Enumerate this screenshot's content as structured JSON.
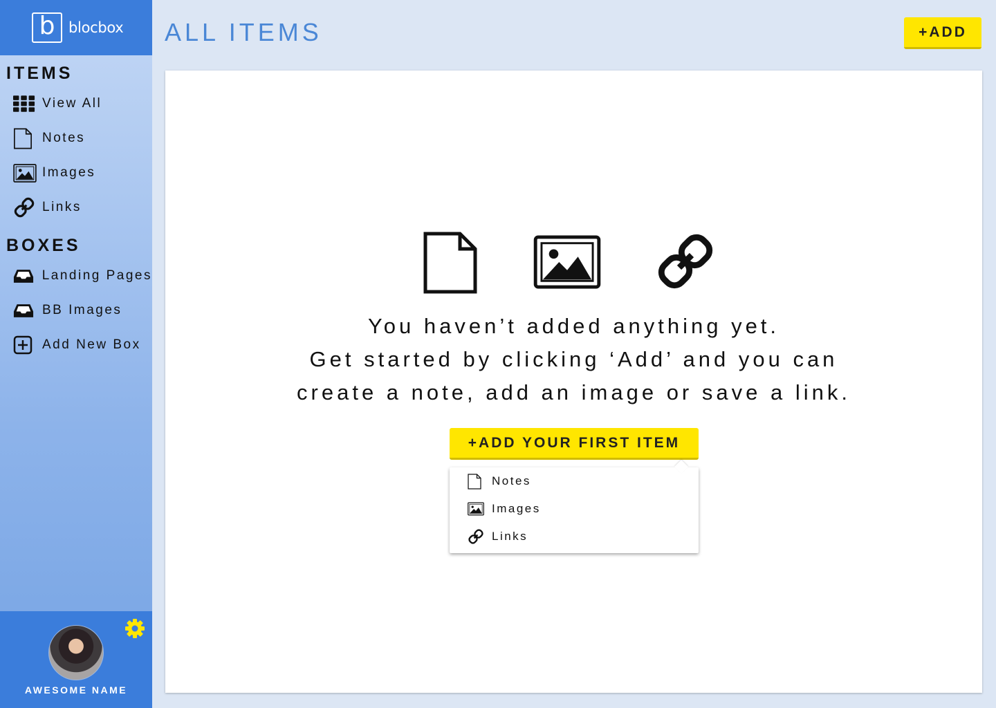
{
  "brand": {
    "logo_letter": "b",
    "name": "blocbox",
    "color": "#3b7ddb"
  },
  "sidebar": {
    "items_title": "ITEMS",
    "items": [
      {
        "label": "View All",
        "icon": "grid-icon"
      },
      {
        "label": "Notes",
        "icon": "document-icon"
      },
      {
        "label": "Images",
        "icon": "image-icon"
      },
      {
        "label": "Links",
        "icon": "link-icon"
      }
    ],
    "boxes_title": "BOXES",
    "boxes": [
      {
        "label": "Landing Pages",
        "icon": "inbox-icon"
      },
      {
        "label": "BB Images",
        "icon": "inbox-icon"
      },
      {
        "label": "Add New Box",
        "icon": "plus-square-icon"
      }
    ]
  },
  "profile": {
    "name": "AWESOME NAME",
    "settings_icon": "gear-icon",
    "gear_color": "#ffe600"
  },
  "header": {
    "title": "ALL ITEMS",
    "add_label": "+ADD",
    "accent": "#ffe600"
  },
  "empty_state": {
    "icons": [
      "document-icon",
      "image-icon",
      "link-icon"
    ],
    "lines": [
      "You haven’t added anything yet.",
      "Get started by clicking ‘Add’ and you can",
      "create a note, add an image or save a link."
    ],
    "button_label": "+ADD YOUR FIRST ITEM"
  },
  "dropdown": {
    "items": [
      {
        "label": "Notes",
        "icon": "document-icon"
      },
      {
        "label": "Images",
        "icon": "image-icon"
      },
      {
        "label": "Links",
        "icon": "link-icon"
      }
    ]
  }
}
